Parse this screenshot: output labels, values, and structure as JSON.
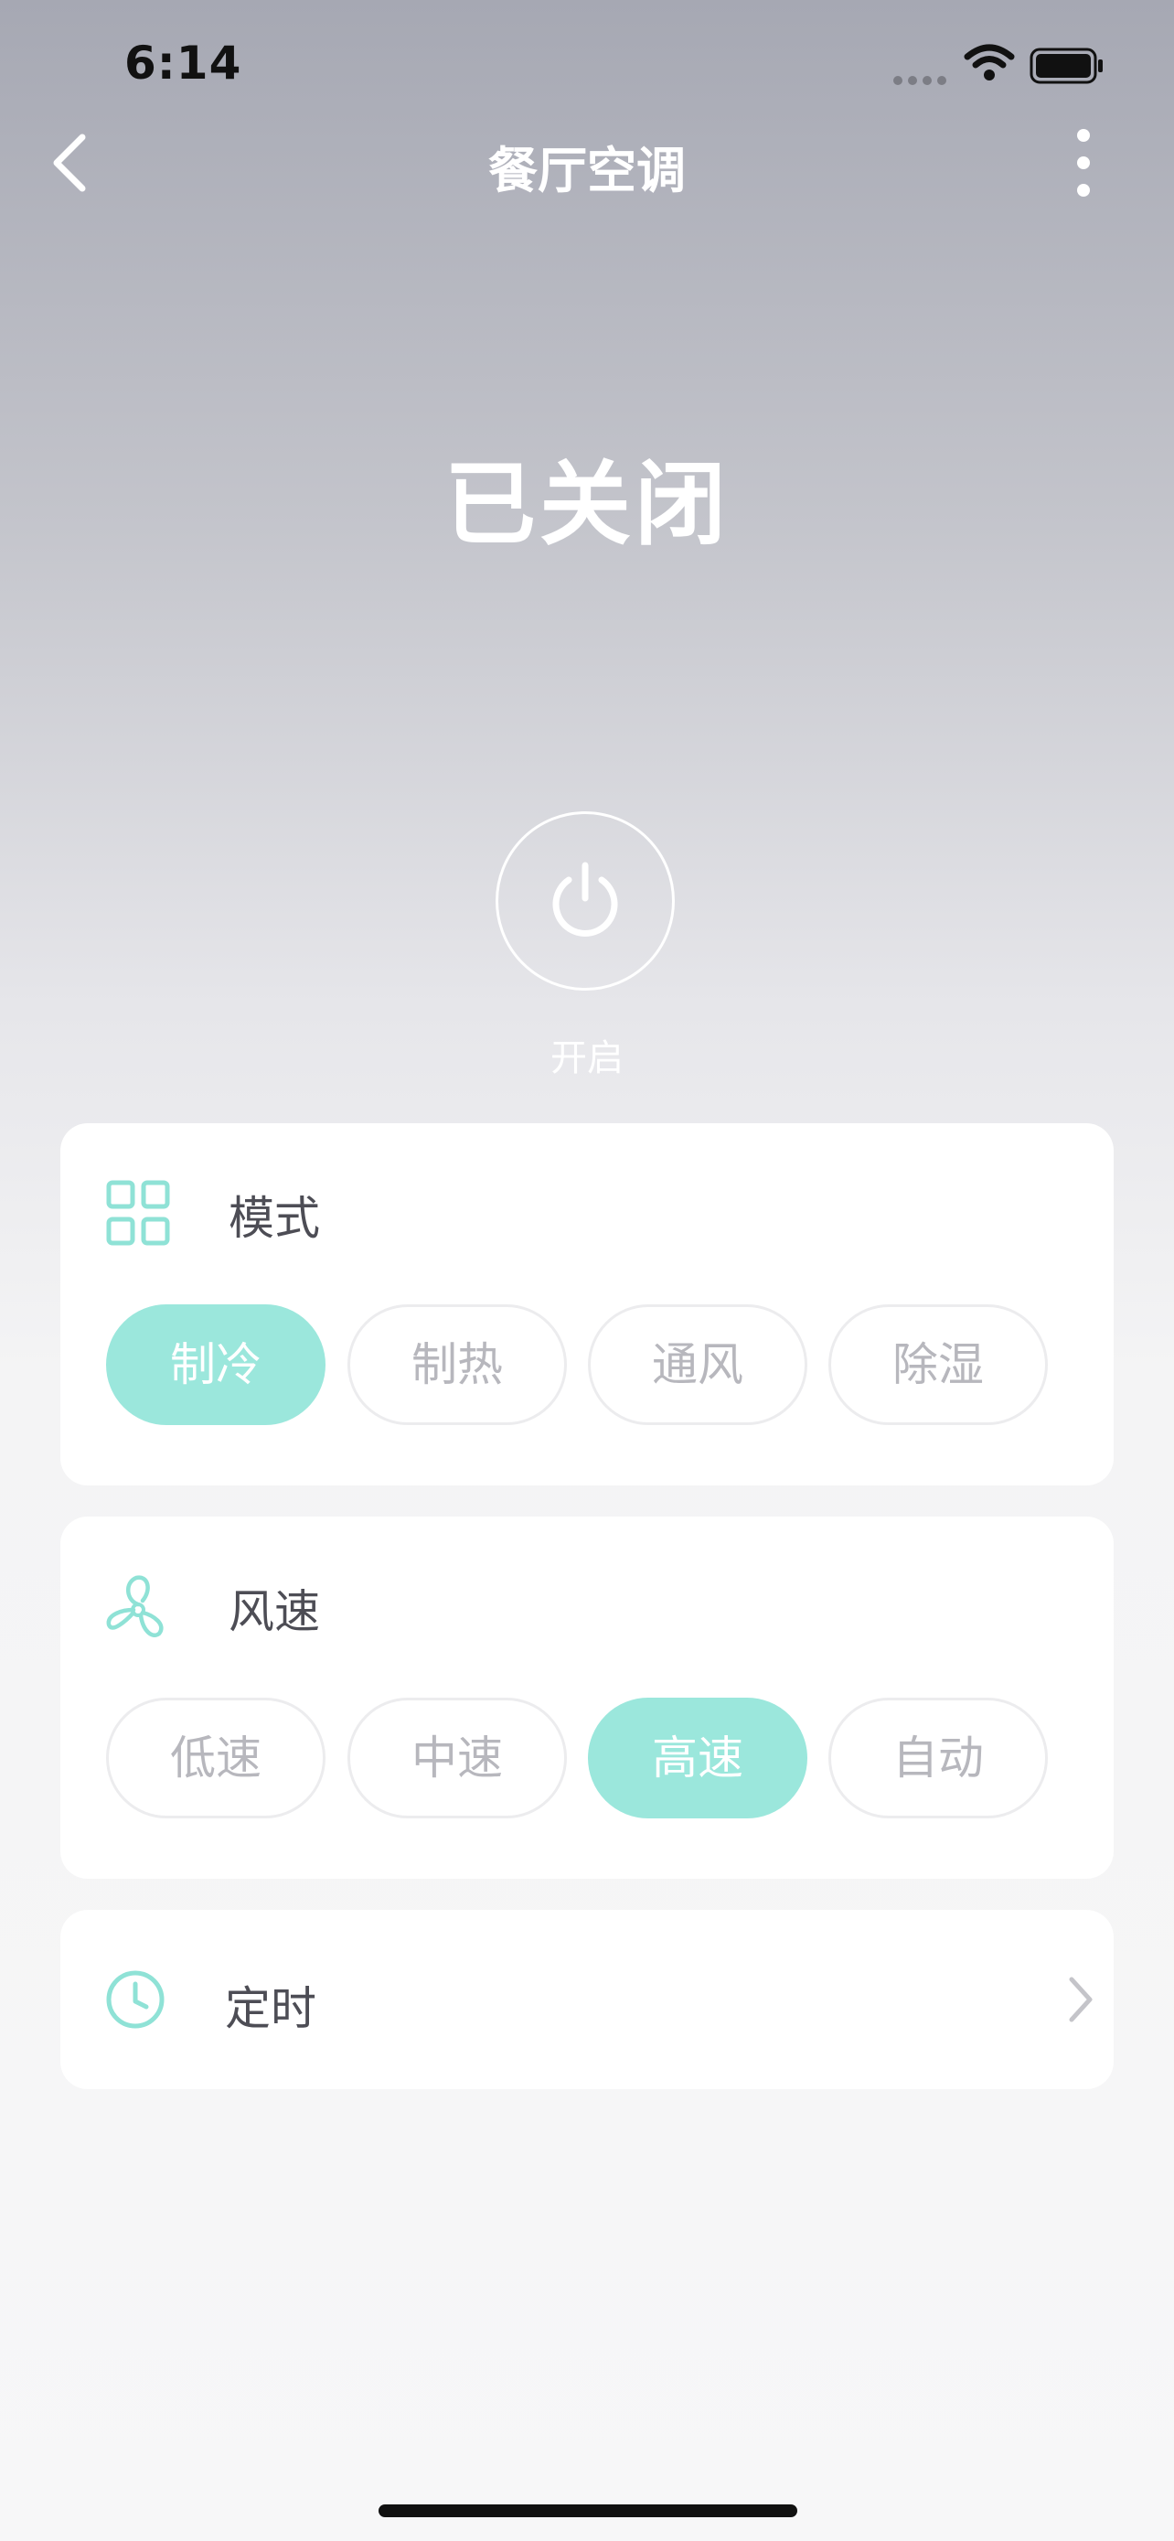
{
  "status_bar": {
    "time": "6:14"
  },
  "header": {
    "title": "餐厅空调"
  },
  "device": {
    "state_text": "已关闭",
    "power_label": "开启"
  },
  "mode": {
    "label": "模式",
    "options": [
      "制冷",
      "制热",
      "通风",
      "除湿"
    ],
    "selected": "制冷"
  },
  "fan": {
    "label": "风速",
    "options": [
      "低速",
      "中速",
      "高速",
      "自动"
    ],
    "selected": "高速"
  },
  "timer": {
    "label": "定时"
  },
  "icons": {
    "back": "chevron-left-icon",
    "more": "more-vertical-icon",
    "power": "power-icon",
    "mode": "grid-icon",
    "fan": "fan-icon",
    "timer": "clock-icon",
    "chevron": "chevron-right-icon"
  },
  "colors": {
    "accent": "#9be7dc",
    "accent_icon": "#8fe2d6",
    "text_dark": "#4d4d55",
    "text_muted": "#b7b7bd"
  }
}
